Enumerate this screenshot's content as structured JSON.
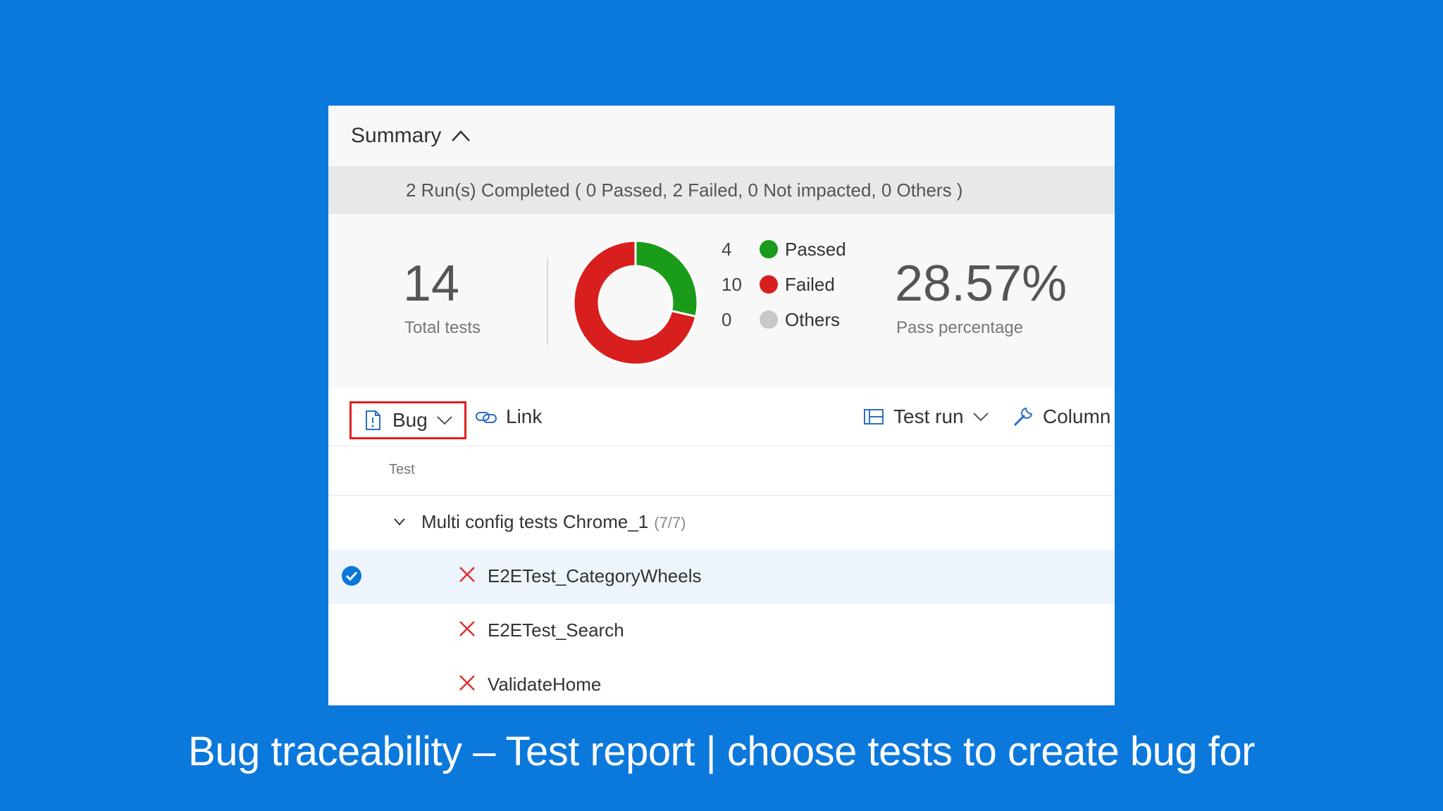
{
  "summary": {
    "title": "Summary",
    "toggle_icon": "chevron-up-icon"
  },
  "runs": {
    "text": "2 Run(s) Completed ( 0 Passed, 2 Failed, 0 Not impacted, 0 Others )"
  },
  "stats": {
    "total": {
      "value": "14",
      "label": "Total tests"
    },
    "legend": [
      {
        "count": "4",
        "label": "Passed",
        "color": "#1a9b1a"
      },
      {
        "count": "10",
        "label": "Failed",
        "color": "#d91e1e"
      },
      {
        "count": "0",
        "label": "Others",
        "color": "#c8c8c8"
      }
    ],
    "pass_percentage": {
      "value": "28.57%",
      "label": "Pass percentage"
    }
  },
  "chart_data": {
    "type": "pie",
    "categories": [
      "Passed",
      "Failed",
      "Others"
    ],
    "values": [
      4,
      10,
      0
    ],
    "colors": [
      "#1a9b1a",
      "#d91e1e",
      "#c8c8c8"
    ],
    "style": "donut"
  },
  "toolbar": {
    "bug_label": "Bug",
    "link_label": "Link",
    "test_run_label": "Test run",
    "column_label": "Column"
  },
  "table": {
    "column_header": "Test",
    "group": {
      "name": "Multi config tests Chrome_1",
      "count": "(7/7)"
    },
    "rows": [
      {
        "name": "E2ETest_CategoryWheels",
        "selected": true,
        "status": "failed"
      },
      {
        "name": "E2ETest_Search",
        "selected": false,
        "status": "failed"
      },
      {
        "name": "ValidateHome",
        "selected": false,
        "status": "failed"
      }
    ]
  },
  "caption": "Bug traceability – Test report | choose tests to create bug for"
}
